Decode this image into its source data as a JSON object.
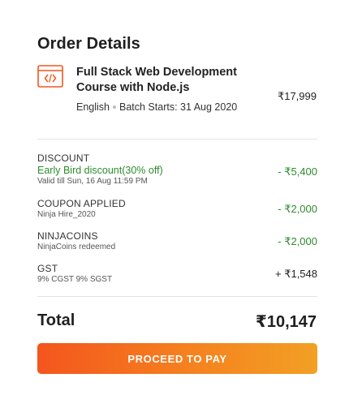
{
  "title": "Order Details",
  "course": {
    "icon": "code-icon",
    "name": "Full Stack Web Development Course with Node.js",
    "language": "English",
    "batch": "Batch Starts: 31 Aug 2020",
    "price": "₹17,999"
  },
  "adjustments": [
    {
      "label": "DISCOUNT",
      "name": "Early Bird discount(30% off)",
      "note": "Valid till Sun, 16 Aug 11:59 PM",
      "amount": "- ₹5,400"
    },
    {
      "label": "COUPON APPLIED",
      "note": "Ninja Hire_2020",
      "amount": "- ₹2,000"
    },
    {
      "label": "NINJACOINS",
      "note": "NinjaCoins redeemed",
      "amount": "- ₹2,000"
    },
    {
      "label": "GST",
      "note": "9% CGST 9% SGST",
      "amount": "+ ₹1,548"
    }
  ],
  "total": {
    "label": "Total",
    "value": "₹10,147"
  },
  "cta": {
    "label": "PROCEED TO PAY"
  },
  "colors": {
    "accent": "#f4551d",
    "discount": "#2e8b2e"
  }
}
